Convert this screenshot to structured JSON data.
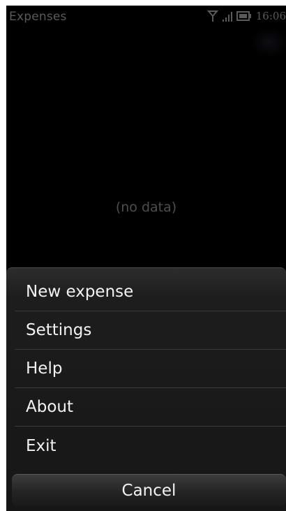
{
  "status_bar": {
    "app_title": "Expenses",
    "time": "16:06",
    "icons": [
      "antenna-icon",
      "signal-icon",
      "battery-icon"
    ]
  },
  "main": {
    "empty_message": "(no data)"
  },
  "menu": {
    "items": [
      {
        "label": "New expense"
      },
      {
        "label": "Settings"
      },
      {
        "label": "Help"
      },
      {
        "label": "About"
      },
      {
        "label": "Exit"
      }
    ],
    "cancel_label": "Cancel"
  },
  "colors": {
    "background": "#000000",
    "menu_background": "#1d1d1d",
    "menu_text": "#f2f2f2",
    "dim_text": "#4e4e4e"
  }
}
